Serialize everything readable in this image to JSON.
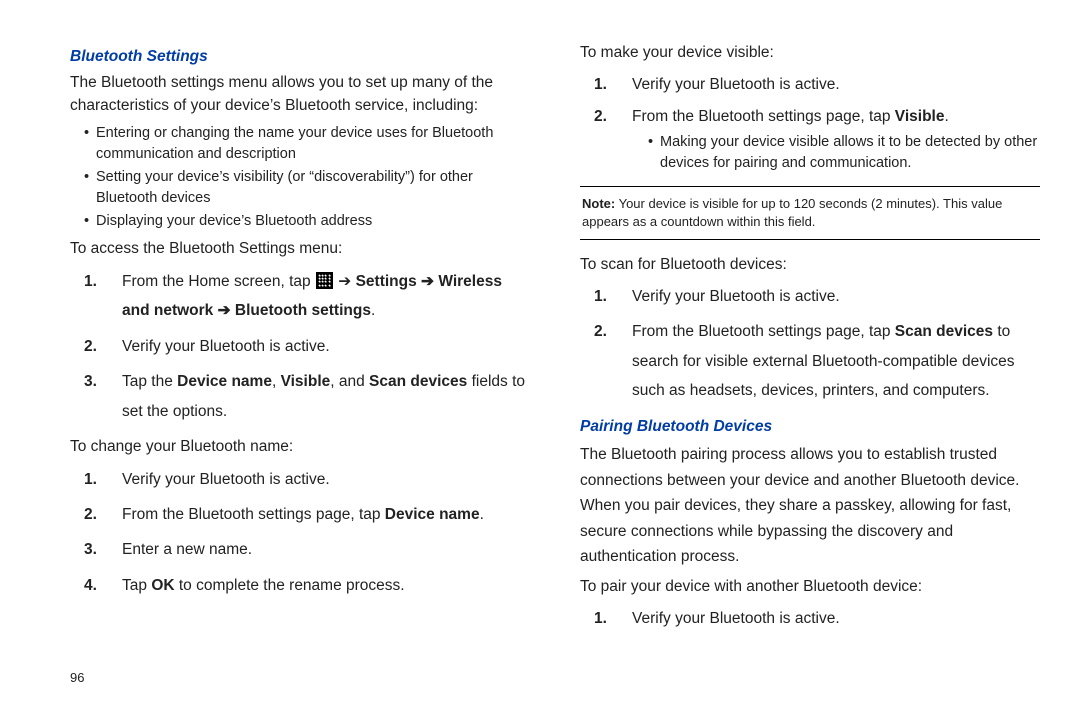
{
  "page_number": "96",
  "left": {
    "heading1": "Bluetooth Settings",
    "intro1": "The Bluetooth settings menu allows you to set up many of the characteristics of your device’s Bluetooth service, including:",
    "includes": [
      "Entering or changing the name your device uses for Bluetooth communication and description",
      "Setting your device’s visibility (or “discoverability”) for other Bluetooth devices",
      "Displaying your device’s Bluetooth address"
    ],
    "access_lead": "To access the Bluetooth Settings menu:",
    "access_step1_prefix": "From the Home screen, tap ",
    "access_step1_bold_tail": "Settings ➔ Wireless and network ➔ Bluetooth settings",
    "access_step1_period": ".",
    "access_step2": "Verify your Bluetooth is active.",
    "access_step3_pre": "Tap the ",
    "access_step3_b1": "Device name",
    "access_step3_mid1": ", ",
    "access_step3_b2": "Visible",
    "access_step3_mid2": ", and ",
    "access_step3_b3": "Scan devices",
    "access_step3_tail": " fields to set the options.",
    "change_lead": "To change your Bluetooth name:",
    "change_step1": "Verify your Bluetooth is active.",
    "change_step2_pre": "From the Bluetooth settings page, tap ",
    "change_step2_b": "Device name",
    "change_step2_tail": ".",
    "change_step3": "Enter a new name.",
    "change_step4_pre": "Tap ",
    "change_step4_b": "OK",
    "change_step4_tail": " to complete the rename process."
  },
  "right": {
    "visible_lead": "To make your device visible:",
    "visible_step1": "Verify your Bluetooth is active.",
    "visible_step2_pre": "From the Bluetooth settings page, tap ",
    "visible_step2_b": "Visible",
    "visible_step2_tail": ".",
    "visible_sub1": "Making your device visible allows it to be detected by other devices for pairing and communication.",
    "note_label": "Note:",
    "note_text": " Your device is visible for up to 120 seconds (2 minutes). This value appears as a countdown within this field.",
    "scan_lead": "To scan for Bluetooth devices:",
    "scan_step1": "Verify your Bluetooth is active.",
    "scan_step2_pre": "From the Bluetooth settings page, tap ",
    "scan_step2_b": "Scan devices",
    "scan_step2_tail": " to search for visible external Bluetooth-compatible devices such as headsets, devices, printers, and computers.",
    "heading2": "Pairing Bluetooth Devices",
    "pair_intro": "The Bluetooth pairing process allows you to establish trusted connections between your device and another Bluetooth device. When you pair devices, they share a passkey, allowing for fast, secure connections while bypassing the discovery and authentication process.",
    "pair_lead": "To pair your device with another Bluetooth device:",
    "pair_step1": "Verify your Bluetooth is active."
  },
  "glyphs": {
    "arrow": "➔"
  }
}
